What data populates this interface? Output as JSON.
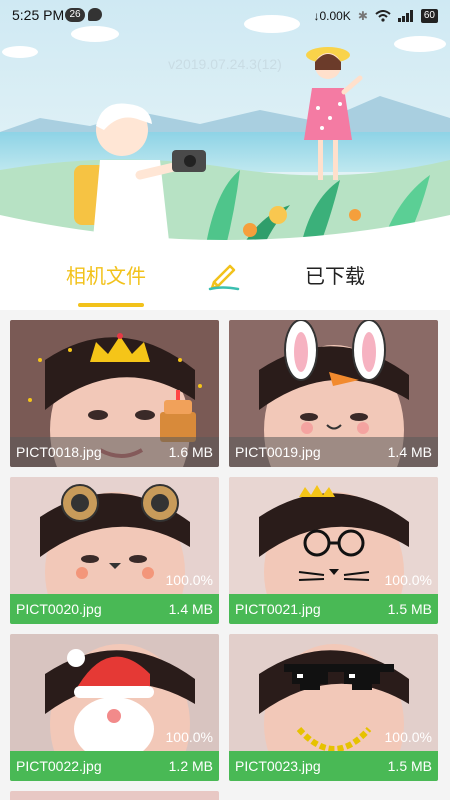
{
  "status_bar": {
    "time": "5:25 PM",
    "notification_count": "26",
    "network_speed": "0.00K",
    "battery": "60"
  },
  "banner": {
    "version": "v2019.07.24.3(12)"
  },
  "tabs": {
    "camera_files": "相机文件",
    "downloaded": "已下载",
    "active": "camera_files"
  },
  "files": [
    {
      "name": "PICT0018.jpg",
      "size": "1.6 MB",
      "progress": "",
      "decoration": "crown-cake"
    },
    {
      "name": "PICT0019.jpg",
      "size": "1.4 MB",
      "progress": "",
      "decoration": "bunny-ears"
    },
    {
      "name": "PICT0020.jpg",
      "size": "1.4 MB",
      "progress": "100.0%",
      "decoration": "bear-ears"
    },
    {
      "name": "PICT0021.jpg",
      "size": "1.5 MB",
      "progress": "100.0%",
      "decoration": "glasses-whiskers"
    },
    {
      "name": "PICT0022.jpg",
      "size": "1.2 MB",
      "progress": "100.0%",
      "decoration": "santa"
    },
    {
      "name": "PICT0023.jpg",
      "size": "1.5 MB",
      "progress": "100.0%",
      "decoration": "pixel-sunglasses"
    }
  ],
  "colors": {
    "accent": "#f2c21b",
    "progress_green": "#49b955"
  }
}
